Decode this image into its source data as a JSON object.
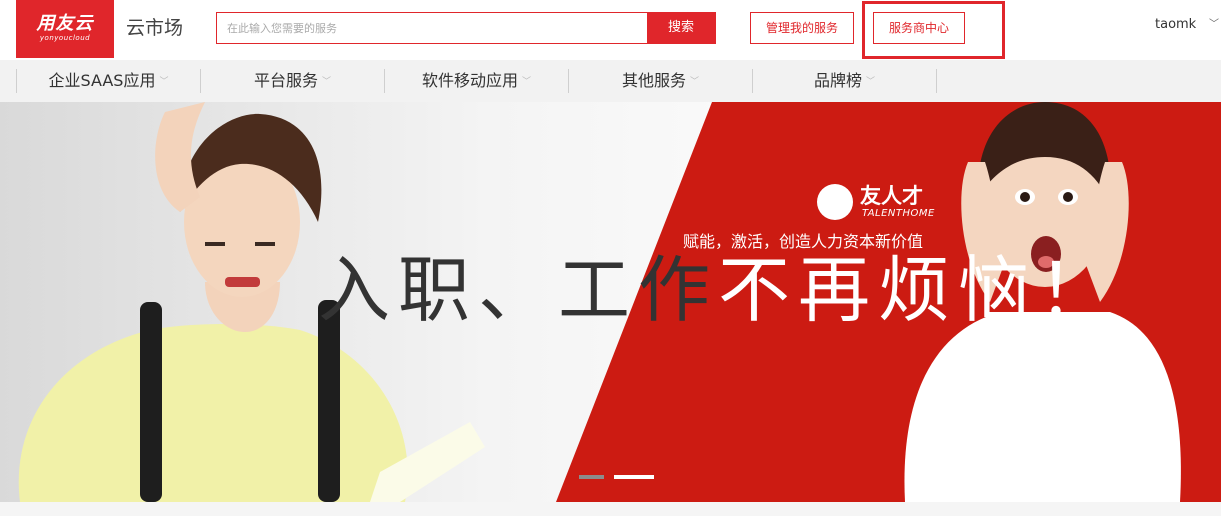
{
  "header": {
    "logo_main": "用友云",
    "logo_sub": "yonyoucloud",
    "site_title": "云市场",
    "search_placeholder": "在此输入您需要的服务",
    "search_button": "搜索",
    "manage_button": "管理我的服务",
    "provider_button": "服务商中心",
    "username": "taomk",
    "chevron": "﹀"
  },
  "nav": {
    "items": [
      {
        "label": "企业SAAS应用"
      },
      {
        "label": "平台服务"
      },
      {
        "label": "软件移动应用"
      },
      {
        "label": "其他服务"
      },
      {
        "label": "品牌榜"
      }
    ],
    "caret": "﹀"
  },
  "banner": {
    "brand_name": "友人才",
    "brand_sub": "TALENTHOME",
    "tagline": "赋能，激活，创造人力资本新价值",
    "slogan_dark": "入职、工作",
    "slogan_light": "不再烦恼！",
    "active_slide": 2,
    "slide_count": 2
  },
  "colors": {
    "brand_red": "#e0262b",
    "banner_red": "#cc1b12",
    "nav_bg": "#f2f2f2"
  }
}
